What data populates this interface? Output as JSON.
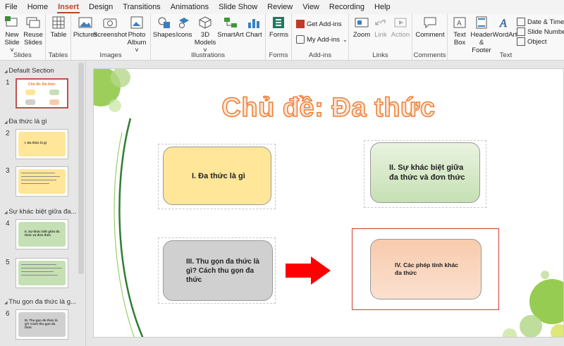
{
  "menu": [
    "File",
    "Home",
    "Insert",
    "Design",
    "Transitions",
    "Animations",
    "Slide Show",
    "Review",
    "View",
    "Recording",
    "Help"
  ],
  "active_tab": "Insert",
  "ribbon": {
    "groups": {
      "slides": "Slides",
      "tables": "Tables",
      "images": "Images",
      "illustrations": "Illustrations",
      "forms": "Forms",
      "addins": "Add-ins",
      "links": "Links",
      "comments": "Comments",
      "text": "Text"
    },
    "buttons": {
      "new_slide": "New Slide ˅",
      "reuse_slides": "Reuse Slides",
      "table": "Table",
      "pictures": "Pictures",
      "screenshot": "Screenshot",
      "photo_album": "Photo Album ˅",
      "shapes": "Shapes",
      "icons": "Icons",
      "models3d": "3D Models ˅",
      "smartart": "SmartArt",
      "chart": "Chart",
      "forms": "Forms",
      "get_addins": "Get Add-ins",
      "my_addins": "My Add-ins",
      "zoom": "Zoom",
      "link": "Link",
      "action": "Action",
      "comment": "Comment",
      "text_box": "Text Box",
      "header_footer": "Header & Footer",
      "wordart": "WordArt",
      "date_time": "Date & Time",
      "slide_number": "Slide Number",
      "object": "Object"
    }
  },
  "sections": [
    {
      "title": "Default Section"
    },
    {
      "title": "Đa thức là gì"
    },
    {
      "title": "Sự khác biệt giữa đa..."
    },
    {
      "title": "Thu gọn đa thức là g..."
    }
  ],
  "thumbnails": [
    {
      "num": "1",
      "text": "Chủ đề: Đa thức"
    },
    {
      "num": "2",
      "text": "I. Đa thức là gì"
    },
    {
      "num": "3",
      "text": ""
    },
    {
      "num": "4",
      "text": "II. Sự khác biệt giữa đa thức và đơn thức"
    },
    {
      "num": "5",
      "text": ""
    },
    {
      "num": "6",
      "text": "III. Thu gọn đa thức là gì? Cách thu gọn đa thức"
    }
  ],
  "slide": {
    "title": "Chủ đề: Đa thức",
    "boxes": {
      "b1": "I. Đa thức là gì",
      "b2": "II. Sự khác biệt giữa đa thức và đơn thức",
      "b3": "III. Thu gọn đa thức là gì? Cách thu gọn đa thức",
      "b4": "IV. Các phép tính khác đa thức"
    }
  },
  "colors": {
    "accent": "#b7472a",
    "title_stroke": "#ed7d31",
    "box1": "#ffe699",
    "box2": "#c5e0b4",
    "box3": "#d0d0d0",
    "box4": "#f8cbad",
    "arrow": "#ff0000",
    "highlight": "#d9382e"
  }
}
